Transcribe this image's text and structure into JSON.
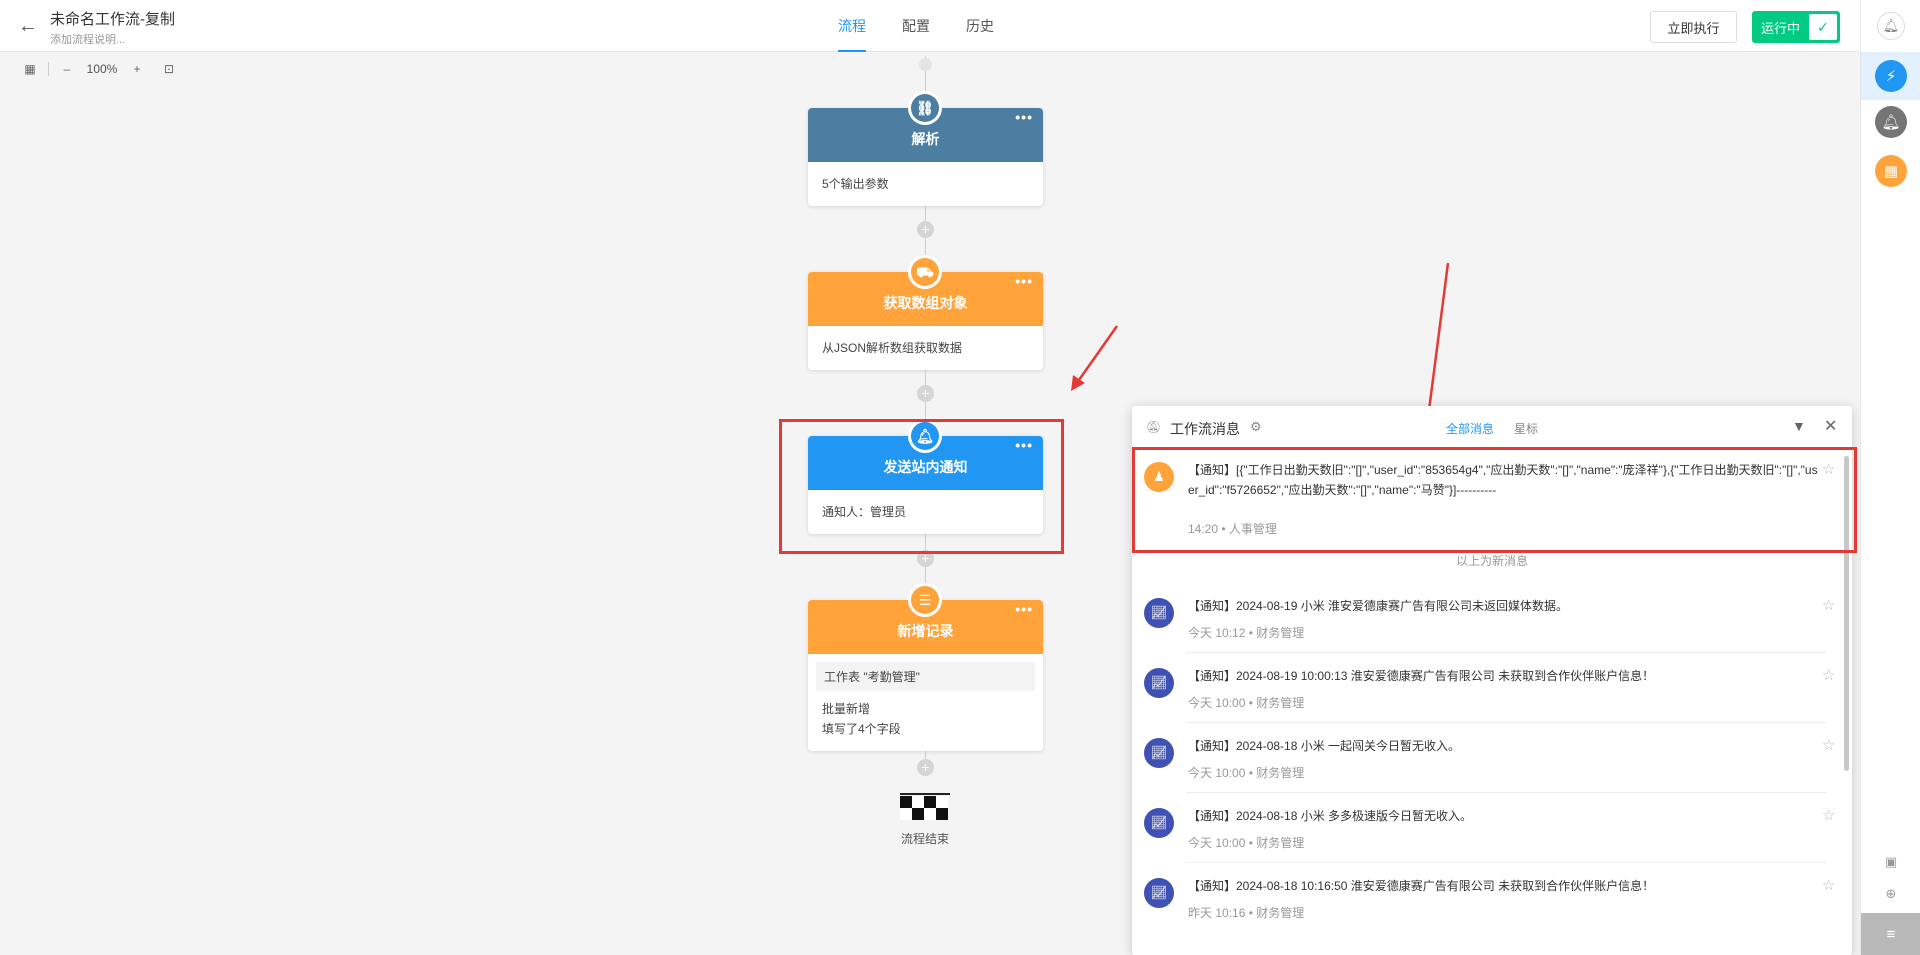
{
  "header": {
    "back_icon": "arrow-left-icon",
    "title": "未命名工作流-复制",
    "subtitle": "添加流程说明...",
    "tabs": [
      {
        "label": "流程",
        "active": true
      },
      {
        "label": "配置",
        "active": false
      },
      {
        "label": "历史",
        "active": false
      }
    ],
    "run_now_label": "立即执行",
    "running_label": "运行中"
  },
  "zoom": {
    "level": "100%",
    "minus": "–",
    "plus": "+"
  },
  "nodes": [
    {
      "title": "解析",
      "color": "#4b7ea1",
      "icon": "link-icon",
      "lines": [
        "5个输出参数"
      ]
    },
    {
      "title": "获取数组对象",
      "color": "#ffa33a",
      "icon": "truck-icon",
      "lines": [
        "从JSON解析数组获取数据"
      ]
    },
    {
      "title": "发送站内通知",
      "color": "#2196f3",
      "icon": "bell-icon",
      "lines": [
        "通知人：管理员"
      ]
    },
    {
      "title": "新增记录",
      "color": "#ffa33a",
      "icon": "add-record-icon",
      "table": "工作表 \"考勤管理\"",
      "lines": [
        "批量新增",
        "填写了4个字段"
      ]
    }
  ],
  "flow_end_label": "流程结束",
  "panel": {
    "title": "工作流消息",
    "tab_all": "全部消息",
    "tab_star": "星标",
    "new_divider": "以上为新消息",
    "messages": [
      {
        "text": "【通知】[{\"工作日出勤天数旧\":\"[]\",\"user_id\":\"853654g4\",\"应出勤天数\":\"[]\",\"name\":\"庞泽祥\"},{\"工作日出勤天数旧\":\"[]\",\"user_id\":\"f5726652\",\"应出勤天数\":\"[]\",\"name\":\"马赞\"}]----------",
        "time": "14:20",
        "source": "人事管理",
        "avatar_color": "#ffa33a",
        "avatar_icon": "person-icon"
      },
      {
        "text": "【通知】2024-08-19 小米 淮安爱德康赛广告有限公司未返回媒体数据。",
        "time": "今天 10:12",
        "source": "财务管理",
        "avatar_color": "#3f51b5",
        "avatar_icon": "chart-icon"
      },
      {
        "text": "【通知】2024-08-19 10:00:13 淮安爱德康赛广告有限公司 未获取到合作伙伴账户信息！",
        "time": "今天 10:00",
        "source": "财务管理",
        "avatar_color": "#3f51b5",
        "avatar_icon": "chart-icon"
      },
      {
        "text": "【通知】2024-08-18 小米 一起闯关今日暂无收入。",
        "time": "今天 10:00",
        "source": "财务管理",
        "avatar_color": "#3f51b5",
        "avatar_icon": "chart-icon"
      },
      {
        "text": "【通知】2024-08-18 小米 多多极速版今日暂无收入。",
        "time": "今天 10:00",
        "source": "财务管理",
        "avatar_color": "#3f51b5",
        "avatar_icon": "chart-icon"
      },
      {
        "text": "【通知】2024-08-18 10:16:50 淮安爱德康赛广告有限公司 未获取到合作伙伴账户信息！",
        "time": "昨天 10:16",
        "source": "财务管理",
        "avatar_color": "#3f51b5",
        "avatar_icon": "chart-icon"
      }
    ],
    "meta_dot": "•"
  },
  "sidebar": {
    "icons": [
      "bell-outline-icon",
      "lightning-icon",
      "bell-icon",
      "grid-icon",
      "contact-icon",
      "chat-add-icon",
      "collapse-icon"
    ],
    "colors": [
      "#2196f3",
      "#757575",
      "#ffa33a"
    ]
  }
}
